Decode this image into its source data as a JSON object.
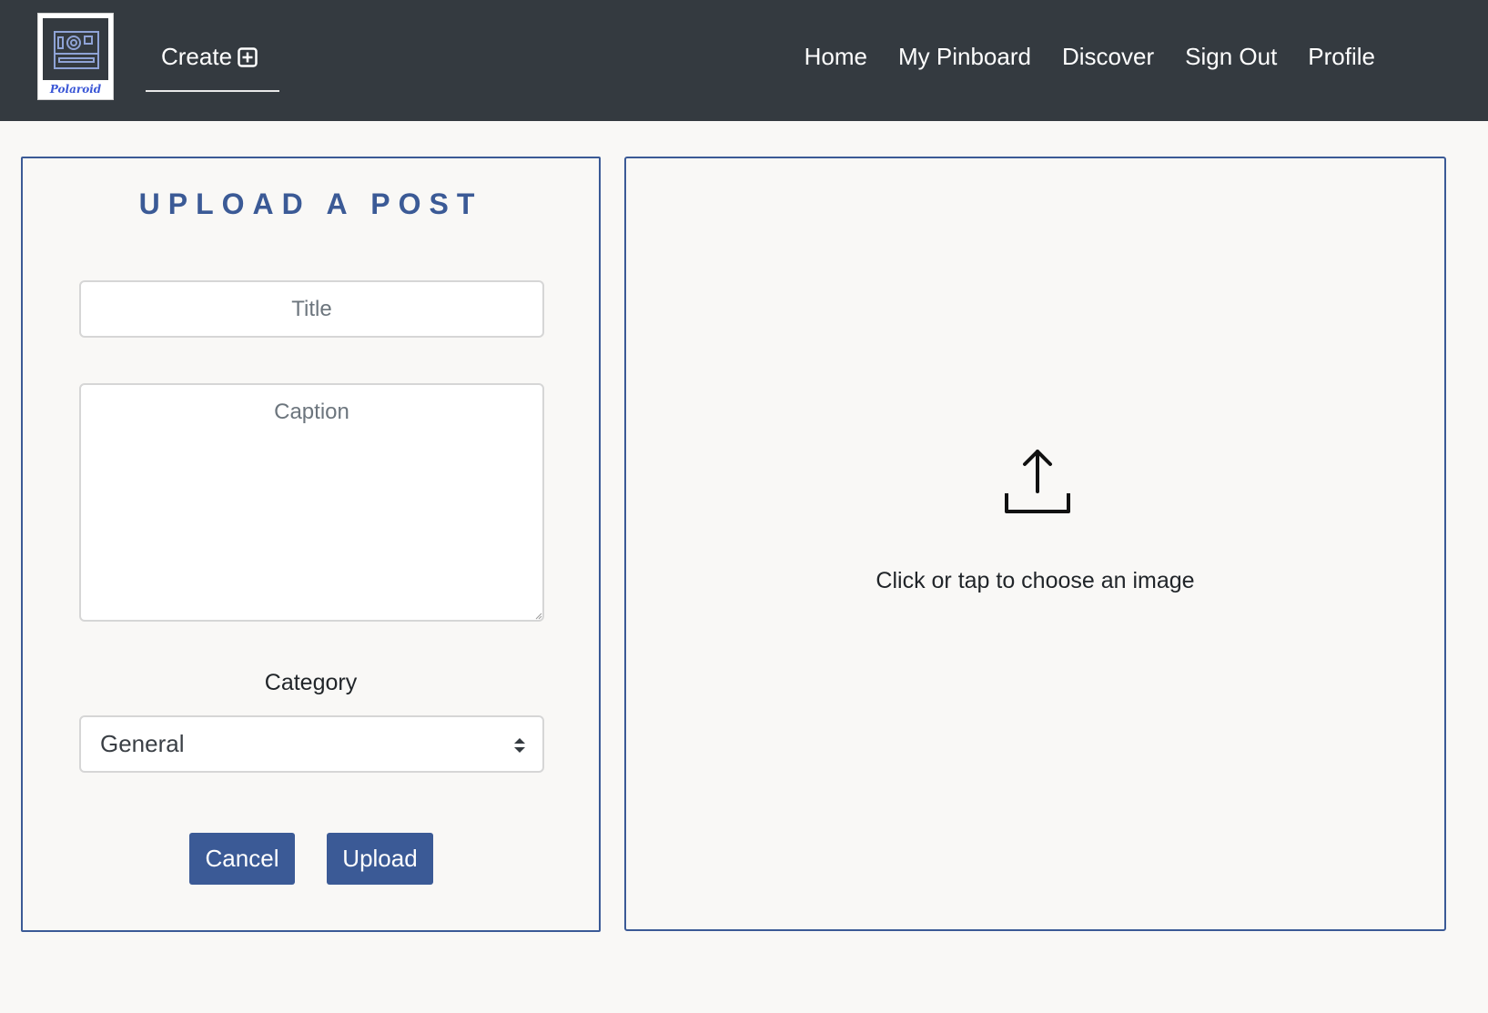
{
  "navbar": {
    "logo": {
      "text": "Polaroid",
      "icon": "camera-icon"
    },
    "create_label": "Create",
    "create_icon": "plus-square-icon",
    "links": [
      "Home",
      "My Pinboard",
      "Discover",
      "Sign Out",
      "Profile"
    ],
    "background": "#343a40"
  },
  "form": {
    "heading": "UPLOAD A POST",
    "title_placeholder": "Title",
    "caption_placeholder": "Caption",
    "category_label": "Category",
    "category_selected": "General",
    "cancel_label": "Cancel",
    "upload_label": "Upload"
  },
  "dropzone": {
    "icon": "upload-icon",
    "text": "Click or tap to choose an image"
  },
  "colors": {
    "accent": "#3b5a96",
    "page_background": "#f9f8f6"
  }
}
